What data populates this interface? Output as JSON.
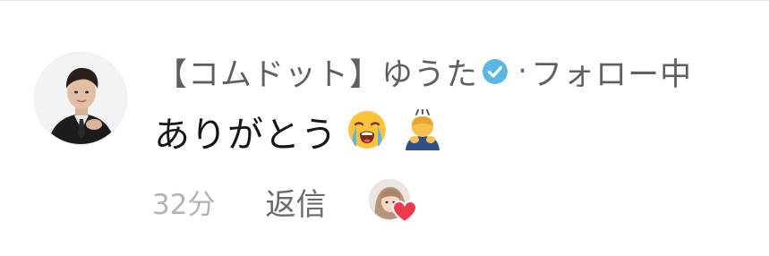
{
  "comment": {
    "author": {
      "name": "【コムドット】ゆうた",
      "verified_icon": "verified-check-icon",
      "separator": "·",
      "follow_status": "フォロー中"
    },
    "text": "ありがとう",
    "emojis": [
      "loudly-crying-face-emoji",
      "person-bowing-emoji"
    ],
    "timestamp": "32分",
    "reply_label": "返信",
    "creator_like": {
      "icon": "heart-icon",
      "heart_color": "#f0384e"
    },
    "colors": {
      "verified_badge": "#57b8e6",
      "author_text": "#5f5f5f",
      "comment_text": "#161616",
      "timestamp_text": "#b3b3b3"
    }
  }
}
